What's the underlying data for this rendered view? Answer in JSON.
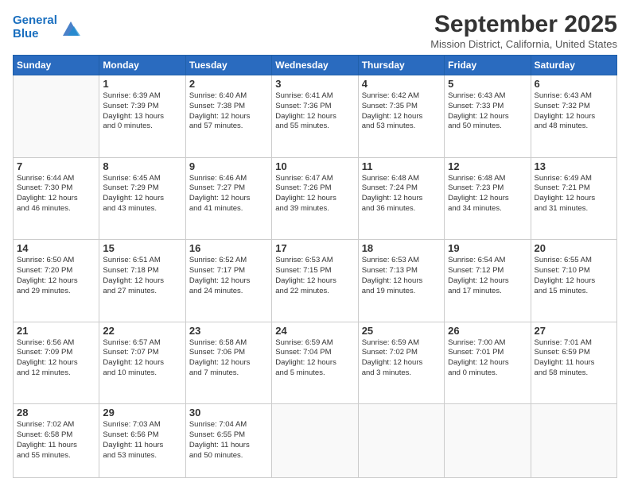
{
  "header": {
    "logo_line1": "General",
    "logo_line2": "Blue",
    "month": "September 2025",
    "location": "Mission District, California, United States"
  },
  "weekdays": [
    "Sunday",
    "Monday",
    "Tuesday",
    "Wednesday",
    "Thursday",
    "Friday",
    "Saturday"
  ],
  "weeks": [
    [
      {
        "day": "",
        "info": ""
      },
      {
        "day": "1",
        "info": "Sunrise: 6:39 AM\nSunset: 7:39 PM\nDaylight: 13 hours\nand 0 minutes."
      },
      {
        "day": "2",
        "info": "Sunrise: 6:40 AM\nSunset: 7:38 PM\nDaylight: 12 hours\nand 57 minutes."
      },
      {
        "day": "3",
        "info": "Sunrise: 6:41 AM\nSunset: 7:36 PM\nDaylight: 12 hours\nand 55 minutes."
      },
      {
        "day": "4",
        "info": "Sunrise: 6:42 AM\nSunset: 7:35 PM\nDaylight: 12 hours\nand 53 minutes."
      },
      {
        "day": "5",
        "info": "Sunrise: 6:43 AM\nSunset: 7:33 PM\nDaylight: 12 hours\nand 50 minutes."
      },
      {
        "day": "6",
        "info": "Sunrise: 6:43 AM\nSunset: 7:32 PM\nDaylight: 12 hours\nand 48 minutes."
      }
    ],
    [
      {
        "day": "7",
        "info": "Sunrise: 6:44 AM\nSunset: 7:30 PM\nDaylight: 12 hours\nand 46 minutes."
      },
      {
        "day": "8",
        "info": "Sunrise: 6:45 AM\nSunset: 7:29 PM\nDaylight: 12 hours\nand 43 minutes."
      },
      {
        "day": "9",
        "info": "Sunrise: 6:46 AM\nSunset: 7:27 PM\nDaylight: 12 hours\nand 41 minutes."
      },
      {
        "day": "10",
        "info": "Sunrise: 6:47 AM\nSunset: 7:26 PM\nDaylight: 12 hours\nand 39 minutes."
      },
      {
        "day": "11",
        "info": "Sunrise: 6:48 AM\nSunset: 7:24 PM\nDaylight: 12 hours\nand 36 minutes."
      },
      {
        "day": "12",
        "info": "Sunrise: 6:48 AM\nSunset: 7:23 PM\nDaylight: 12 hours\nand 34 minutes."
      },
      {
        "day": "13",
        "info": "Sunrise: 6:49 AM\nSunset: 7:21 PM\nDaylight: 12 hours\nand 31 minutes."
      }
    ],
    [
      {
        "day": "14",
        "info": "Sunrise: 6:50 AM\nSunset: 7:20 PM\nDaylight: 12 hours\nand 29 minutes."
      },
      {
        "day": "15",
        "info": "Sunrise: 6:51 AM\nSunset: 7:18 PM\nDaylight: 12 hours\nand 27 minutes."
      },
      {
        "day": "16",
        "info": "Sunrise: 6:52 AM\nSunset: 7:17 PM\nDaylight: 12 hours\nand 24 minutes."
      },
      {
        "day": "17",
        "info": "Sunrise: 6:53 AM\nSunset: 7:15 PM\nDaylight: 12 hours\nand 22 minutes."
      },
      {
        "day": "18",
        "info": "Sunrise: 6:53 AM\nSunset: 7:13 PM\nDaylight: 12 hours\nand 19 minutes."
      },
      {
        "day": "19",
        "info": "Sunrise: 6:54 AM\nSunset: 7:12 PM\nDaylight: 12 hours\nand 17 minutes."
      },
      {
        "day": "20",
        "info": "Sunrise: 6:55 AM\nSunset: 7:10 PM\nDaylight: 12 hours\nand 15 minutes."
      }
    ],
    [
      {
        "day": "21",
        "info": "Sunrise: 6:56 AM\nSunset: 7:09 PM\nDaylight: 12 hours\nand 12 minutes."
      },
      {
        "day": "22",
        "info": "Sunrise: 6:57 AM\nSunset: 7:07 PM\nDaylight: 12 hours\nand 10 minutes."
      },
      {
        "day": "23",
        "info": "Sunrise: 6:58 AM\nSunset: 7:06 PM\nDaylight: 12 hours\nand 7 minutes."
      },
      {
        "day": "24",
        "info": "Sunrise: 6:59 AM\nSunset: 7:04 PM\nDaylight: 12 hours\nand 5 minutes."
      },
      {
        "day": "25",
        "info": "Sunrise: 6:59 AM\nSunset: 7:02 PM\nDaylight: 12 hours\nand 3 minutes."
      },
      {
        "day": "26",
        "info": "Sunrise: 7:00 AM\nSunset: 7:01 PM\nDaylight: 12 hours\nand 0 minutes."
      },
      {
        "day": "27",
        "info": "Sunrise: 7:01 AM\nSunset: 6:59 PM\nDaylight: 11 hours\nand 58 minutes."
      }
    ],
    [
      {
        "day": "28",
        "info": "Sunrise: 7:02 AM\nSunset: 6:58 PM\nDaylight: 11 hours\nand 55 minutes."
      },
      {
        "day": "29",
        "info": "Sunrise: 7:03 AM\nSunset: 6:56 PM\nDaylight: 11 hours\nand 53 minutes."
      },
      {
        "day": "30",
        "info": "Sunrise: 7:04 AM\nSunset: 6:55 PM\nDaylight: 11 hours\nand 50 minutes."
      },
      {
        "day": "",
        "info": ""
      },
      {
        "day": "",
        "info": ""
      },
      {
        "day": "",
        "info": ""
      },
      {
        "day": "",
        "info": ""
      }
    ]
  ]
}
